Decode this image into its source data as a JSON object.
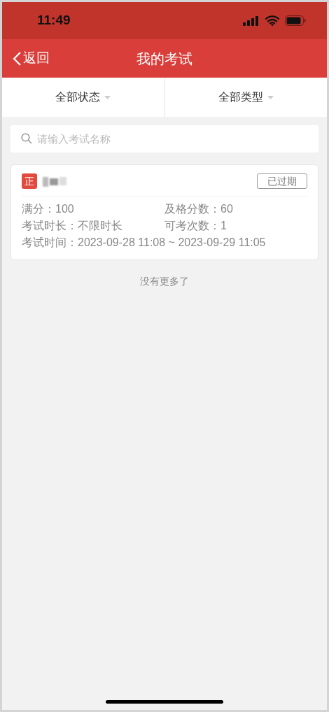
{
  "status_bar": {
    "time": "11:49"
  },
  "nav_bar": {
    "back": "返回",
    "title": "我的考试"
  },
  "filters": [
    {
      "label": "全部状态"
    },
    {
      "label": "全部类型"
    }
  ],
  "search": {
    "placeholder": "请输入考试名称"
  },
  "exams": [
    {
      "tag": "正",
      "status": "已过期",
      "fields": [
        {
          "label": "满分：",
          "value": "100"
        },
        {
          "label": "及格分数：",
          "value": "60"
        },
        {
          "label": "考试时长：",
          "value": "不限时长"
        },
        {
          "label": "可考次数：",
          "value": "1"
        },
        {
          "label": "考试时间：",
          "value": "2023-09-28 11:08 ~ 2023-09-29 11:05",
          "wide": true
        }
      ]
    }
  ],
  "footer": "没有更多了"
}
